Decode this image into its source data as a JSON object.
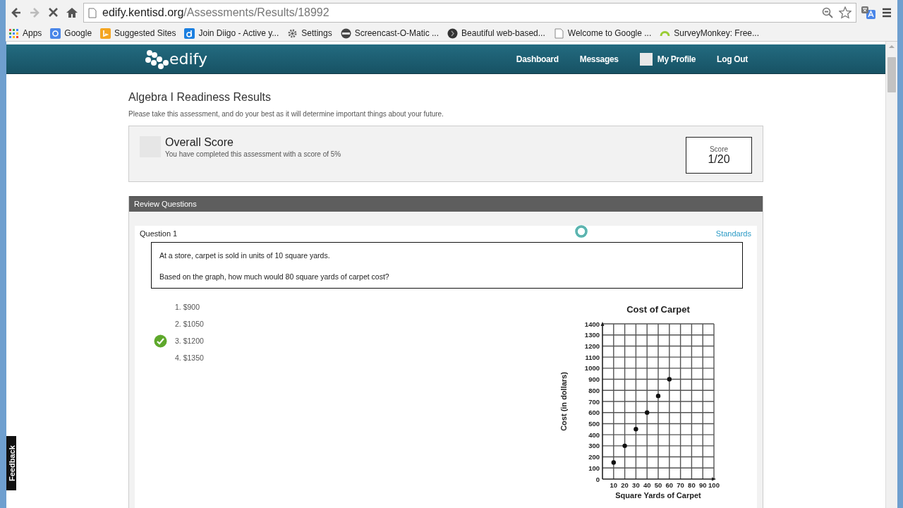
{
  "browser": {
    "url": {
      "host": "edify.kentisd.org",
      "path": "/Assessments/Results/18992"
    },
    "bookmarks": [
      {
        "label": "Apps"
      },
      {
        "label": "Google"
      },
      {
        "label": "Suggested Sites"
      },
      {
        "label": "Join Diigo - Active y..."
      },
      {
        "label": "Settings"
      },
      {
        "label": "Screencast-O-Matic ..."
      },
      {
        "label": "Beautiful web-based..."
      },
      {
        "label": "Welcome to Google ..."
      },
      {
        "label": "SurveyMonkey: Free..."
      }
    ]
  },
  "header": {
    "logo": "edify",
    "nav": [
      {
        "label": "Dashboard",
        "kind": "link"
      },
      {
        "label": "Messages",
        "kind": "link"
      },
      {
        "label": "My Profile",
        "kind": "profile"
      },
      {
        "label": "Log Out",
        "kind": "link"
      }
    ]
  },
  "page": {
    "title": "Algebra I Readiness Results",
    "subtitle": "Please take this assessment, and do your best as it will determine important things about your future.",
    "overall": {
      "title": "Overall Score",
      "text": "You have completed this assessment with a score of 5%",
      "score_label": "Score",
      "score": "1/20"
    },
    "review": {
      "title": "Review Questions",
      "question": {
        "label": "Question 1",
        "standards": "Standards",
        "prompt": [
          "At a store, carpet is sold in units of 10 square yards.",
          "Based on the graph, how much would 80 square yards of carpet cost?"
        ],
        "choices": [
          {
            "label": "1. $900",
            "correct": false
          },
          {
            "label": "2. $1050",
            "correct": false
          },
          {
            "label": "3. $1200",
            "correct": true
          },
          {
            "label": "4. $1350",
            "correct": false
          }
        ],
        "chart_data": {
          "type": "scatter",
          "grid": true,
          "title": "Cost of Carpet",
          "xlabel": "Square Yards of Carpet",
          "ylabel": "Cost (in dollars)",
          "xlim": [
            0,
            100
          ],
          "ylim": [
            0,
            1400
          ],
          "xticks": [
            10,
            20,
            30,
            40,
            50,
            60,
            70,
            80,
            90,
            100
          ],
          "yticks": [
            0,
            100,
            200,
            300,
            400,
            500,
            600,
            700,
            800,
            900,
            1000,
            1100,
            1200,
            1300,
            1400
          ],
          "x": [
            10,
            20,
            30,
            40,
            50,
            60
          ],
          "series": [
            {
              "color": "#111111",
              "values": [
                150,
                300,
                450,
                600,
                750,
                900
              ]
            }
          ]
        }
      }
    }
  },
  "feedback": "Feedback"
}
